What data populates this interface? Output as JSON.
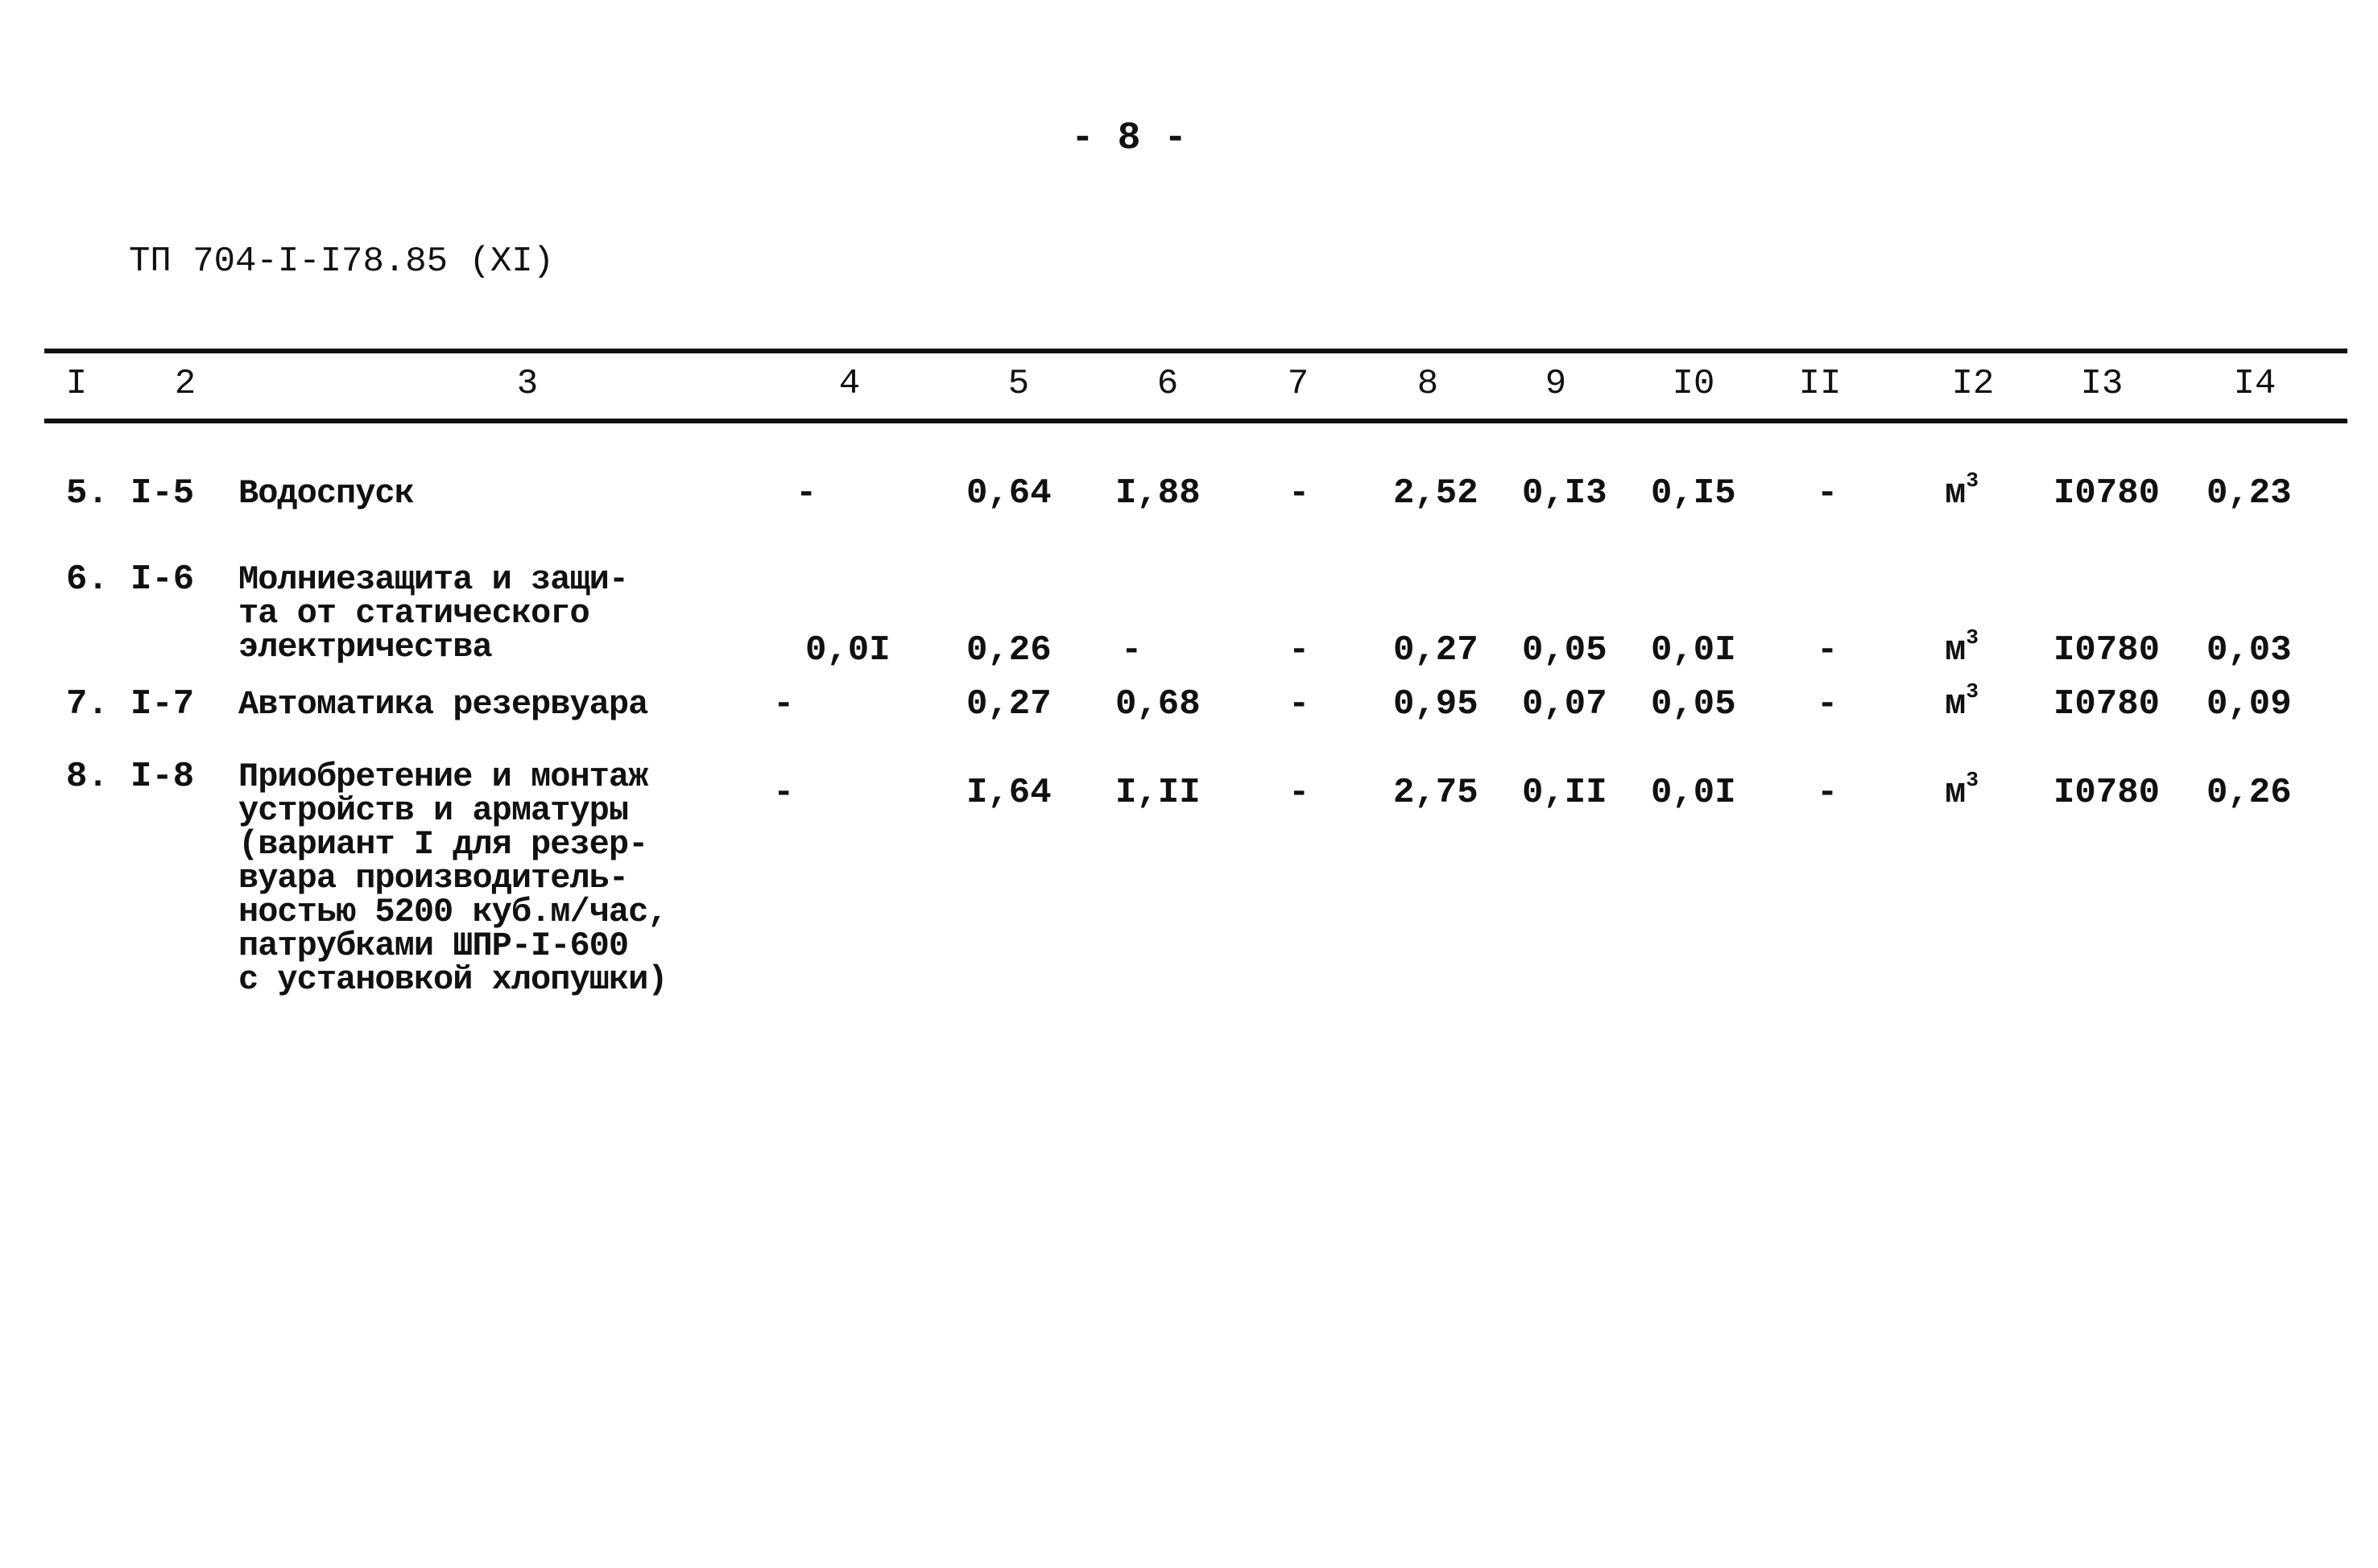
{
  "page": {
    "number": "- 8 -",
    "doc_code": "ТП 704-I-I78.85 (XI)"
  },
  "table": {
    "headers": [
      "I",
      "2",
      "3",
      "4",
      "5",
      "6",
      "7",
      "8",
      "9",
      "I0",
      "II",
      "I2",
      "I3",
      "I4"
    ],
    "rows": [
      {
        "num": "5.",
        "code": "I-5",
        "desc": [
          "Водоспуск"
        ],
        "c4": "-",
        "c5": "0,64",
        "c6": "I,88",
        "c7": "-",
        "c8": "2,52",
        "c9": "0,I3",
        "c10": "0,I5",
        "c11": "-",
        "c12_unit": "м",
        "c12_sup": "3",
        "c13": "I0780",
        "c14": "0,23"
      },
      {
        "num": "6.",
        "code": "I-6",
        "desc": [
          "Молниезащита и защи-",
          "та от статического",
          "электричества"
        ],
        "c4": "0,0I",
        "c5": "0,26",
        "c6": "-",
        "c7": "-",
        "c8": "0,27",
        "c9": "0,05",
        "c10": "0,0I",
        "c11": "-",
        "c12_unit": "м",
        "c12_sup": "3",
        "c13": "I0780",
        "c14": "0,03"
      },
      {
        "num": "7.",
        "code": "I-7",
        "desc": [
          "Автоматика резервуара"
        ],
        "c4": "-",
        "c5": "0,27",
        "c6": "0,68",
        "c7": "-",
        "c8": "0,95",
        "c9": "0,07",
        "c10": "0,05",
        "c11": "-",
        "c12_unit": "м",
        "c12_sup": "3",
        "c13": "I0780",
        "c14": "0,09"
      },
      {
        "num": "8.",
        "code": "I-8",
        "desc": [
          "Приобретение и монтаж",
          "устройств и арматуры",
          "(вариант I для резер-",
          "вуара производитель-",
          "ностью 5200 куб.м/час,",
          "патрубками ШПР-I-600",
          "с установкой хлопушки)"
        ],
        "c4": "-",
        "c5": "I,64",
        "c6": "I,II",
        "c7": "-",
        "c8": "2,75",
        "c9": "0,II",
        "c10": "0,0I",
        "c11": "-",
        "c12_unit": "м",
        "c12_sup": "3",
        "c13": "I0780",
        "c14": "0,26"
      }
    ]
  }
}
